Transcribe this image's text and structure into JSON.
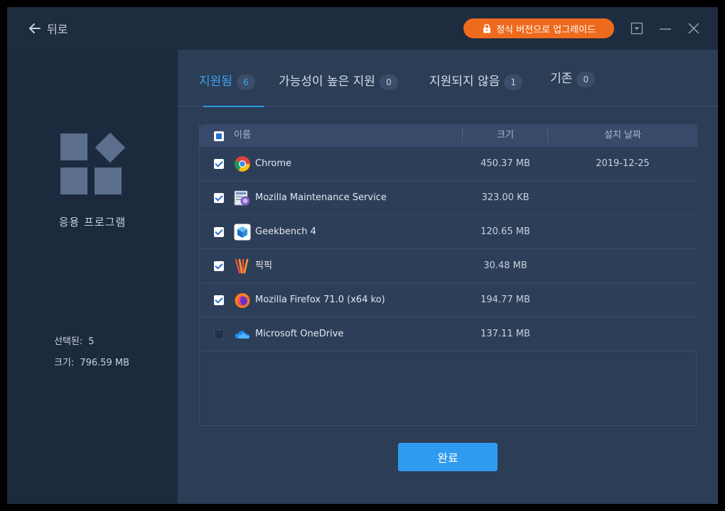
{
  "titlebar": {
    "back_label": "뒤로",
    "upgrade_label": "정식 버전으로 업그레이드"
  },
  "sidebar": {
    "category_label": "응용 프로그램",
    "selected_label": "선택된:",
    "selected_value": "5",
    "size_label": "크기:",
    "size_value": "796.59 MB"
  },
  "tabs": [
    {
      "label": "지원됨",
      "count": "6",
      "active": true
    },
    {
      "label": "가능성이 높은 지원",
      "count": "0",
      "active": false
    },
    {
      "label": "지원되지 않음",
      "count": "1",
      "active": false
    },
    {
      "label": "기존",
      "count": "0",
      "active": false
    }
  ],
  "table": {
    "columns": {
      "name": "이름",
      "size": "크기",
      "date": "설치 날짜"
    },
    "rows": [
      {
        "name": "Chrome",
        "size": "450.37 MB",
        "date": "2019-12-25",
        "checked": true,
        "icon": "chrome-icon"
      },
      {
        "name": "Mozilla Maintenance Service",
        "size": "323.00 KB",
        "date": "",
        "checked": true,
        "icon": "mozilla-maintenance-icon"
      },
      {
        "name": "Geekbench 4",
        "size": "120.65 MB",
        "date": "",
        "checked": true,
        "icon": "geekbench-icon"
      },
      {
        "name": "픽픽",
        "size": "30.48 MB",
        "date": "",
        "checked": true,
        "icon": "picpick-icon"
      },
      {
        "name": "Mozilla Firefox 71.0 (x64 ko)",
        "size": "194.77 MB",
        "date": "",
        "checked": true,
        "icon": "firefox-icon"
      },
      {
        "name": "Microsoft OneDrive",
        "size": "137.11 MB",
        "date": "",
        "checked": false,
        "icon": "onedrive-icon"
      }
    ]
  },
  "footer": {
    "done_label": "완료"
  },
  "colors": {
    "accent": "#2f9bee",
    "upgrade": "#ee6a1c",
    "background": "#2c3d56"
  }
}
